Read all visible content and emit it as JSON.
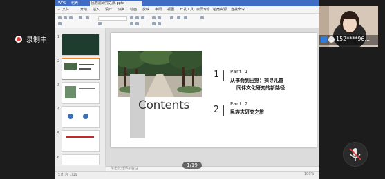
{
  "recording": {
    "label": "录制中"
  },
  "app": {
    "tabs": [
      "WPS",
      "稻壳",
      "民族志研究之旅.pptx"
    ],
    "menu": [
      "三",
      "文件",
      "开始",
      "插入",
      "设计",
      "切换",
      "动画",
      "放映",
      "审阅",
      "视图",
      "开发工具",
      "会员专享",
      "稻壳资源",
      "查找命令"
    ],
    "notes_placeholder": "单击此处添加备注",
    "status_left": "幻灯片 1/19",
    "status_right": "100%"
  },
  "slide": {
    "title": "Contents",
    "items": [
      {
        "num": "1",
        "part": "Part 1",
        "title_line1": "从书斋到田野：探寻儿童",
        "title_line2": "同伴文化研究的新路径"
      },
      {
        "num": "2",
        "part": "Part 2",
        "title_line1": "民族志研究之旅",
        "title_line2": ""
      }
    ]
  },
  "page_indicator": "1/19",
  "participant": {
    "name": "152****96..."
  },
  "colors": {
    "title_bar": "#3f6cc4",
    "record_dot": "#e53935",
    "selected_thumb": "#f08a24"
  }
}
